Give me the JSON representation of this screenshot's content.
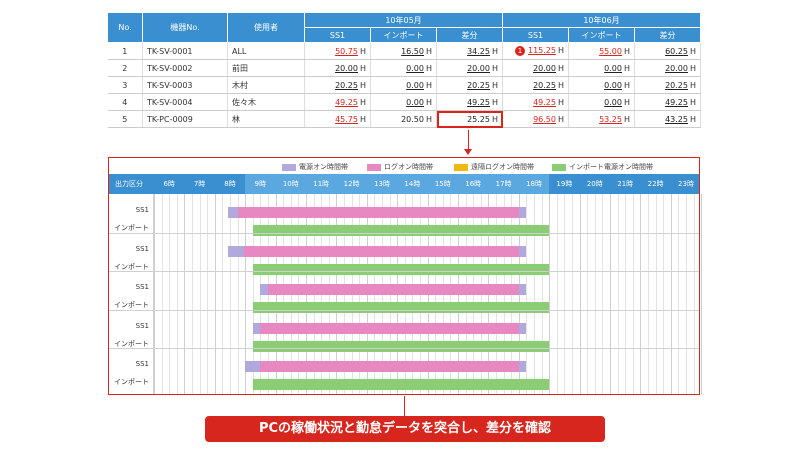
{
  "table": {
    "headers": {
      "no": "No.",
      "device": "機器No.",
      "user": "使用者",
      "month1": "10年05月",
      "month2": "10年06月",
      "sub": [
        "SS1",
        "インポート",
        "差分",
        "SS1",
        "インポート",
        "差分"
      ]
    },
    "unit": "H",
    "rows": [
      {
        "no": "1",
        "device": "TK-SV-0001",
        "user": "ALL",
        "vals": [
          "50.75",
          "16.50",
          "34.25",
          "115.25",
          "55.00",
          "60.25"
        ],
        "styles": [
          "red",
          "blk",
          "blk",
          "red",
          "red",
          "blk"
        ],
        "alert": "1"
      },
      {
        "no": "2",
        "device": "TK-SV-0002",
        "user": "前田",
        "vals": [
          "20.00",
          "0.00",
          "20.00",
          "20.00",
          "0.00",
          "20.00"
        ],
        "styles": [
          "blk",
          "blk",
          "blk",
          "blk",
          "blk",
          "blk"
        ]
      },
      {
        "no": "3",
        "device": "TK-SV-0003",
        "user": "木村",
        "vals": [
          "20.25",
          "0.00",
          "20.25",
          "20.25",
          "0.00",
          "20.25"
        ],
        "styles": [
          "blk",
          "blk",
          "blk",
          "blk",
          "blk",
          "blk"
        ]
      },
      {
        "no": "4",
        "device": "TK-SV-0004",
        "user": "佐々木",
        "vals": [
          "49.25",
          "0.00",
          "49.25",
          "49.25",
          "0.00",
          "49.25"
        ],
        "styles": [
          "red",
          "blk",
          "blk",
          "red",
          "blk",
          "blk"
        ]
      },
      {
        "no": "5",
        "device": "TK-PC-0009",
        "user": "林",
        "vals": [
          "45.75",
          "20.50",
          "25.25",
          "96.50",
          "53.25",
          "43.25"
        ],
        "styles": [
          "red",
          "plain",
          "plain",
          "red",
          "red",
          "blk"
        ]
      }
    ]
  },
  "legend": [
    {
      "label": "電源オン時間帯",
      "color": "#b1a9dd"
    },
    {
      "label": "ログオン時間帯",
      "color": "#e888c3"
    },
    {
      "label": "遠隔ログオン時間帯",
      "color": "#f1b814"
    },
    {
      "label": "インポート電源オン時間帯",
      "color": "#8acd74"
    }
  ],
  "gantt": {
    "header_label": "出力区分",
    "hours": [
      "6時",
      "7時",
      "8時",
      "9時",
      "10時",
      "11時",
      "12時",
      "13時",
      "14時",
      "15時",
      "16時",
      "17時",
      "18時",
      "19時",
      "20時",
      "21時",
      "22時",
      "23時"
    ],
    "row_labels": {
      "ss1": "SS1",
      "import": "インポート"
    },
    "days": [
      {
        "power_start": 8.45,
        "logon_start": 8.75,
        "logon_end": 18.0,
        "power_end": 18.25,
        "import_start": 9.25,
        "import_end": 19.0
      },
      {
        "power_start": 8.45,
        "logon_start": 8.95,
        "logon_end": 18.0,
        "power_end": 18.25,
        "import_start": 9.25,
        "import_end": 19.0
      },
      {
        "power_start": 9.5,
        "logon_start": 9.75,
        "logon_end": 18.0,
        "power_end": 18.25,
        "import_start": 9.25,
        "import_end": 19.0
      },
      {
        "power_start": 9.25,
        "logon_start": 9.5,
        "logon_end": 18.0,
        "power_end": 18.25,
        "import_start": 9.25,
        "import_end": 19.0
      },
      {
        "power_start": 9.0,
        "logon_start": 9.5,
        "logon_end": 18.0,
        "power_end": 18.25,
        "import_start": 9.25,
        "import_end": 19.0
      }
    ]
  },
  "banner": "PCの稼働状況と勤怠データを突合し、差分を確認"
}
